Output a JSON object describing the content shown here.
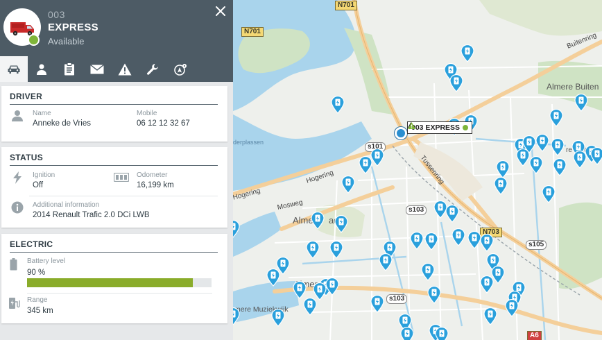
{
  "vehicle": {
    "number": "003",
    "name": "EXPRESS",
    "status": "Available",
    "status_color": "#7fb539"
  },
  "tabs": [
    {
      "icon": "car-icon",
      "active": true
    },
    {
      "icon": "driver-icon",
      "active": false
    },
    {
      "icon": "clipboard-icon",
      "active": false
    },
    {
      "icon": "envelope-icon",
      "active": false
    },
    {
      "icon": "warning-icon",
      "active": false
    },
    {
      "icon": "wrench-icon",
      "active": false
    },
    {
      "icon": "location-settings-icon",
      "active": false
    }
  ],
  "driver": {
    "title": "DRIVER",
    "name_label": "Name",
    "name": "Anneke de Vries",
    "mobile_label": "Mobile",
    "mobile": "06 12 12 32 67"
  },
  "status": {
    "title": "STATUS",
    "ignition_label": "Ignition",
    "ignition": "Off",
    "odometer_label": "Odometer",
    "odometer": "16,199 km",
    "info_label": "Additional information",
    "info": "2014 Renault Trafic 2.0 DCi LWB"
  },
  "electric": {
    "title": "ELECTRIC",
    "battery_label": "Battery level",
    "battery_text": "90 %",
    "battery_fraction": 0.9,
    "battery_color": "#8aac2a",
    "range_label": "Range",
    "range": "345 km"
  },
  "map": {
    "vehicle_label": "003 EXPRESS",
    "road_labels": {
      "n701_top": "N701",
      "n701_left": "N701",
      "s101": "s101",
      "s103_a": "s103",
      "s103_b": "s103",
      "n703": "N703",
      "s105": "s105",
      "a6": "A6"
    },
    "streets": {
      "buitenring": "Buitenring",
      "tussenring": "Tussenring",
      "hogering": "Hogering",
      "hogering_left": "Hogering",
      "mosweg": "Mosweg"
    },
    "places": {
      "almere_buiten_1": "Almere Buiten",
      "almere_buiten_2": "re Buiten",
      "almere_stad": "Almere",
      "almere_stad_suffix": "ad",
      "almere_haven": "Almere",
      "muziekwijk": "mere Muziekwijk",
      "plassen": "derplassen"
    },
    "pin_color": "#2aa0dc",
    "water_color": "#a9d4ec",
    "park_color": "#cfe3c4"
  }
}
